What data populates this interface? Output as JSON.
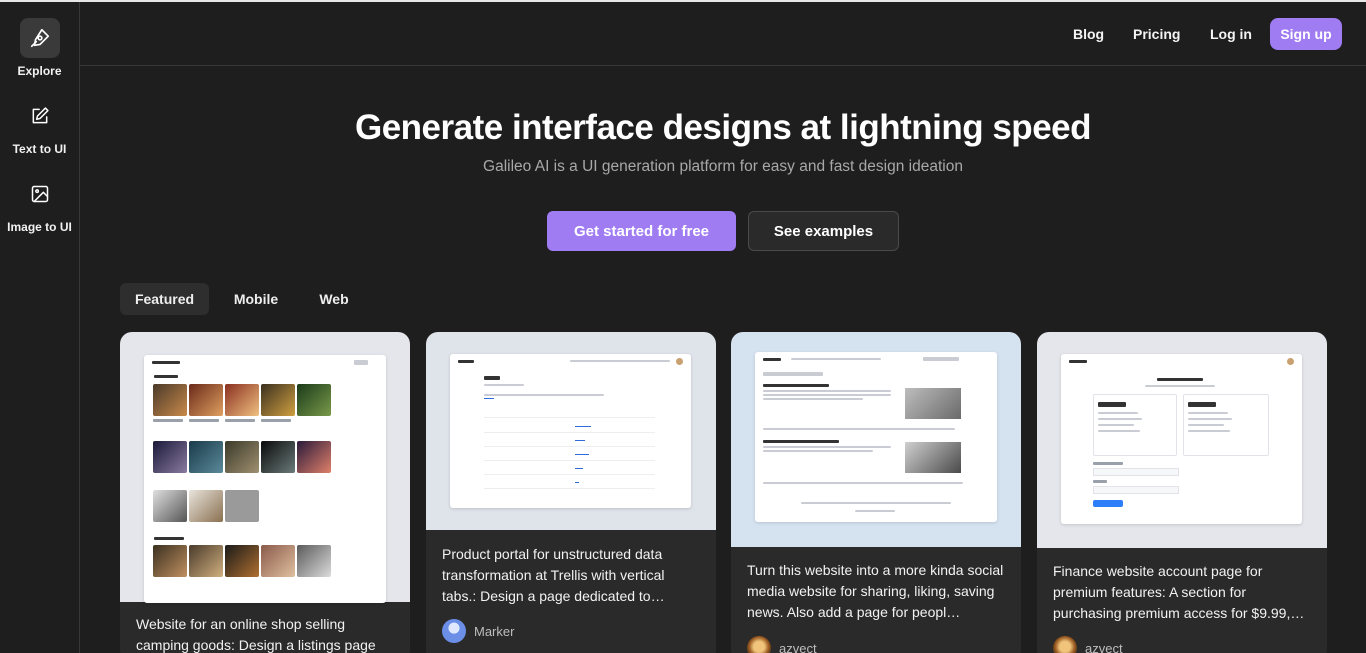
{
  "sidebar": {
    "items": [
      {
        "label": "Explore",
        "icon": "pen-nib-icon",
        "active": true
      },
      {
        "label": "Text to UI",
        "icon": "edit-icon",
        "active": false
      },
      {
        "label": "Image to UI",
        "icon": "image-icon",
        "active": false
      }
    ]
  },
  "header": {
    "links": [
      "Blog",
      "Pricing",
      "Log in"
    ],
    "signup_label": "Sign up"
  },
  "hero": {
    "title": "Generate interface designs at lightning speed",
    "subtitle": "Galileo AI is a UI generation platform for easy and fast design ideation",
    "primary_cta": "Get started for free",
    "secondary_cta": "See examples"
  },
  "tabs": [
    {
      "label": "Featured",
      "active": true
    },
    {
      "label": "Mobile",
      "active": false
    },
    {
      "label": "Web",
      "active": false
    }
  ],
  "cards": [
    {
      "caption": "Website for an online shop selling camping goods: Design a listings page",
      "author": ""
    },
    {
      "caption": "Product portal for unstructured data transformation at Trellis with vertical tabs.: Design a page dedicated to…",
      "author": "Marker"
    },
    {
      "caption": "Turn this website into a more kinda social media website for sharing, liking, saving news. Also add a page for peopl…",
      "author": "azvect"
    },
    {
      "caption": "Finance website account page for premium features: A section for purchasing premium access for $9.99,…",
      "author": "azvect"
    }
  ],
  "colors": {
    "background": "#1e1e1e",
    "accent": "#a07cf3",
    "card": "#2a2a2a",
    "muted_text": "#a8a8a8"
  }
}
